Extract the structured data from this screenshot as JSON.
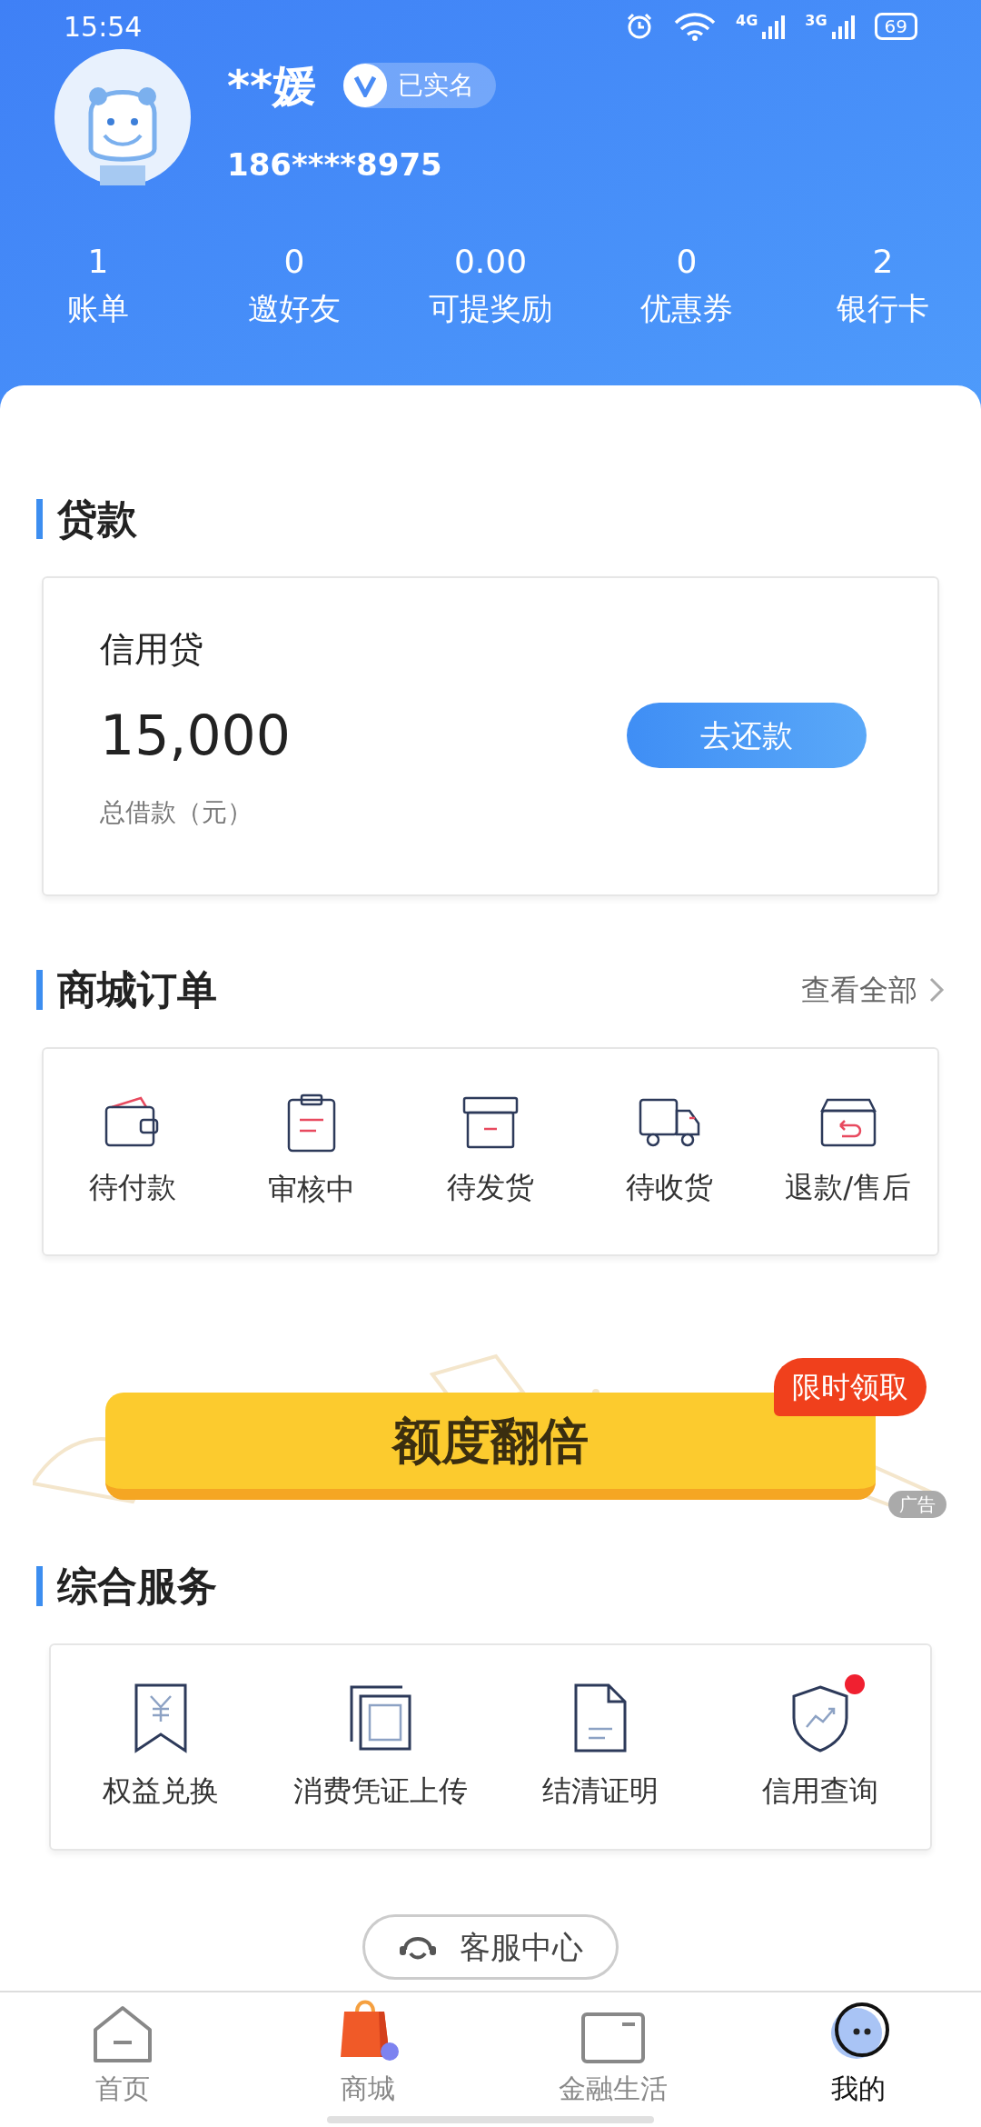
{
  "status_bar": {
    "time": "15:54",
    "battery": "69",
    "net1": "4G",
    "net2": "3G"
  },
  "profile": {
    "name": "**媛",
    "verified_badge": "已实名",
    "phone": "186****8975"
  },
  "stats": [
    {
      "value": "1",
      "label": "账单"
    },
    {
      "value": "0",
      "label": "邀好友"
    },
    {
      "value": "0.00",
      "label": "可提奖励"
    },
    {
      "value": "0",
      "label": "优惠券"
    },
    {
      "value": "2",
      "label": "银行卡"
    }
  ],
  "loan": {
    "title": "贷款",
    "product": "信用贷",
    "amount": "15,000",
    "amount_label": "总借款（元）",
    "button": "去还款"
  },
  "orders": {
    "title": "商城订单",
    "view_all": "查看全部",
    "items": [
      {
        "kind": "wallet",
        "label": "待付款"
      },
      {
        "kind": "clipboard",
        "label": "审核中"
      },
      {
        "kind": "box",
        "label": "待发货"
      },
      {
        "kind": "truck",
        "label": "待收货"
      },
      {
        "kind": "return",
        "label": "退款/售后"
      }
    ]
  },
  "banner": {
    "text": "额度翻倍",
    "tag": "限时领取",
    "ad_label": "广告"
  },
  "services": {
    "title": "综合服务",
    "items": [
      {
        "kind": "voucher",
        "label": "权益兑换",
        "dot": false
      },
      {
        "kind": "copy",
        "label": "消费凭证上传",
        "dot": false
      },
      {
        "kind": "document",
        "label": "结清证明",
        "dot": false
      },
      {
        "kind": "shield",
        "label": "信用查询",
        "dot": true
      }
    ]
  },
  "support_button": "客服中心",
  "nav": [
    {
      "kind": "home",
      "label": "首页",
      "selected": false
    },
    {
      "kind": "shop",
      "label": "商城",
      "selected": false
    },
    {
      "kind": "card",
      "label": "金融生活",
      "selected": false
    },
    {
      "kind": "me",
      "label": "我的",
      "selected": true
    }
  ]
}
